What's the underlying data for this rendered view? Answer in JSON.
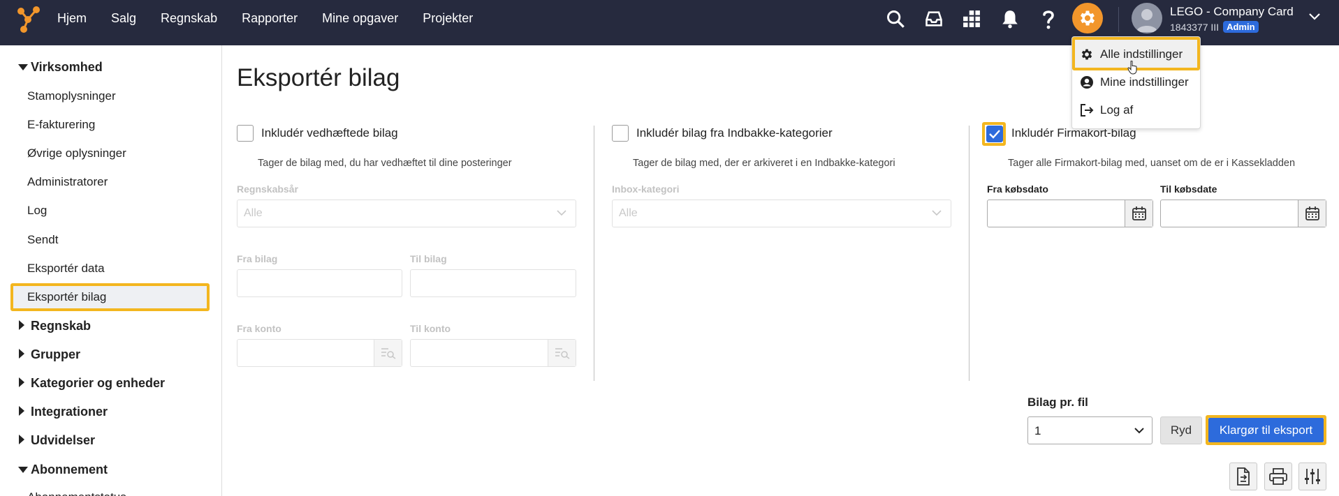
{
  "nav": {
    "items": [
      "Hjem",
      "Salg",
      "Regnskab",
      "Rapporter",
      "Mine opgaver",
      "Projekter"
    ],
    "icons": [
      "search-icon",
      "inbox-icon",
      "apps-grid-icon",
      "bell-icon",
      "help-icon",
      "gear-icon"
    ]
  },
  "account": {
    "company": "LEGO - Company Card",
    "id": "1843377 III",
    "role": "Admin"
  },
  "settings_menu": {
    "items": [
      {
        "label": "Alle indstillinger",
        "icon": "gear-icon"
      },
      {
        "label": "Mine indstillinger",
        "icon": "user-circle-icon"
      },
      {
        "label": "Log af",
        "icon": "logout-icon"
      }
    ]
  },
  "sidebar": {
    "groups": [
      {
        "label": "Virksomhed",
        "expanded": true
      },
      {
        "label": "Regnskab",
        "expanded": false
      },
      {
        "label": "Grupper",
        "expanded": false
      },
      {
        "label": "Kategorier og enheder",
        "expanded": false
      },
      {
        "label": "Integrationer",
        "expanded": false
      },
      {
        "label": "Udvidelser",
        "expanded": false
      },
      {
        "label": "Abonnement",
        "expanded": true
      }
    ],
    "items": [
      "Stamoplysninger",
      "E-fakturering",
      "Øvrige oplysninger",
      "Administratorer",
      "Log",
      "Sendt",
      "Eksportér data",
      "Eksportér bilag"
    ],
    "active": "Eksportér bilag",
    "cutoff_item": "Abonnementstatus"
  },
  "main": {
    "title": "Eksportér bilag",
    "col1": {
      "checkbox_label": "Inkludér vedhæftede bilag",
      "checked": false,
      "help": "Tager de bilag med, du har vedhæftet til dine posteringer",
      "regnskabsaar_label": "Regnskabsår",
      "regnskabsaar_value": "Alle",
      "fra_bilag_label": "Fra bilag",
      "til_bilag_label": "Til bilag",
      "fra_konto_label": "Fra konto",
      "til_konto_label": "Til konto"
    },
    "col2": {
      "checkbox_label": "Inkludér bilag fra Indbakke-kategorier",
      "checked": false,
      "help": "Tager de bilag med, der er arkiveret i en Indbakke-kategori",
      "inbox_label": "Inbox-kategori",
      "inbox_value": "Alle"
    },
    "col3": {
      "checkbox_label": "Inkludér Firmakort-bilag",
      "checked": true,
      "help": "Tager alle Firmakort-bilag med, uanset om de er i Kassekladden",
      "fra_label": "Fra købsdato",
      "til_label": "Til købsdate"
    },
    "bilag_pr_fil_label": "Bilag pr. fil",
    "bilag_pr_fil_value": "1",
    "ryd_label": "Ryd",
    "export_label": "Klargør til eksport"
  },
  "colors": {
    "topbar": "#262a3e",
    "accent": "#f2962b",
    "primary": "#2d6bdc",
    "highlight": "#f3b61f"
  }
}
